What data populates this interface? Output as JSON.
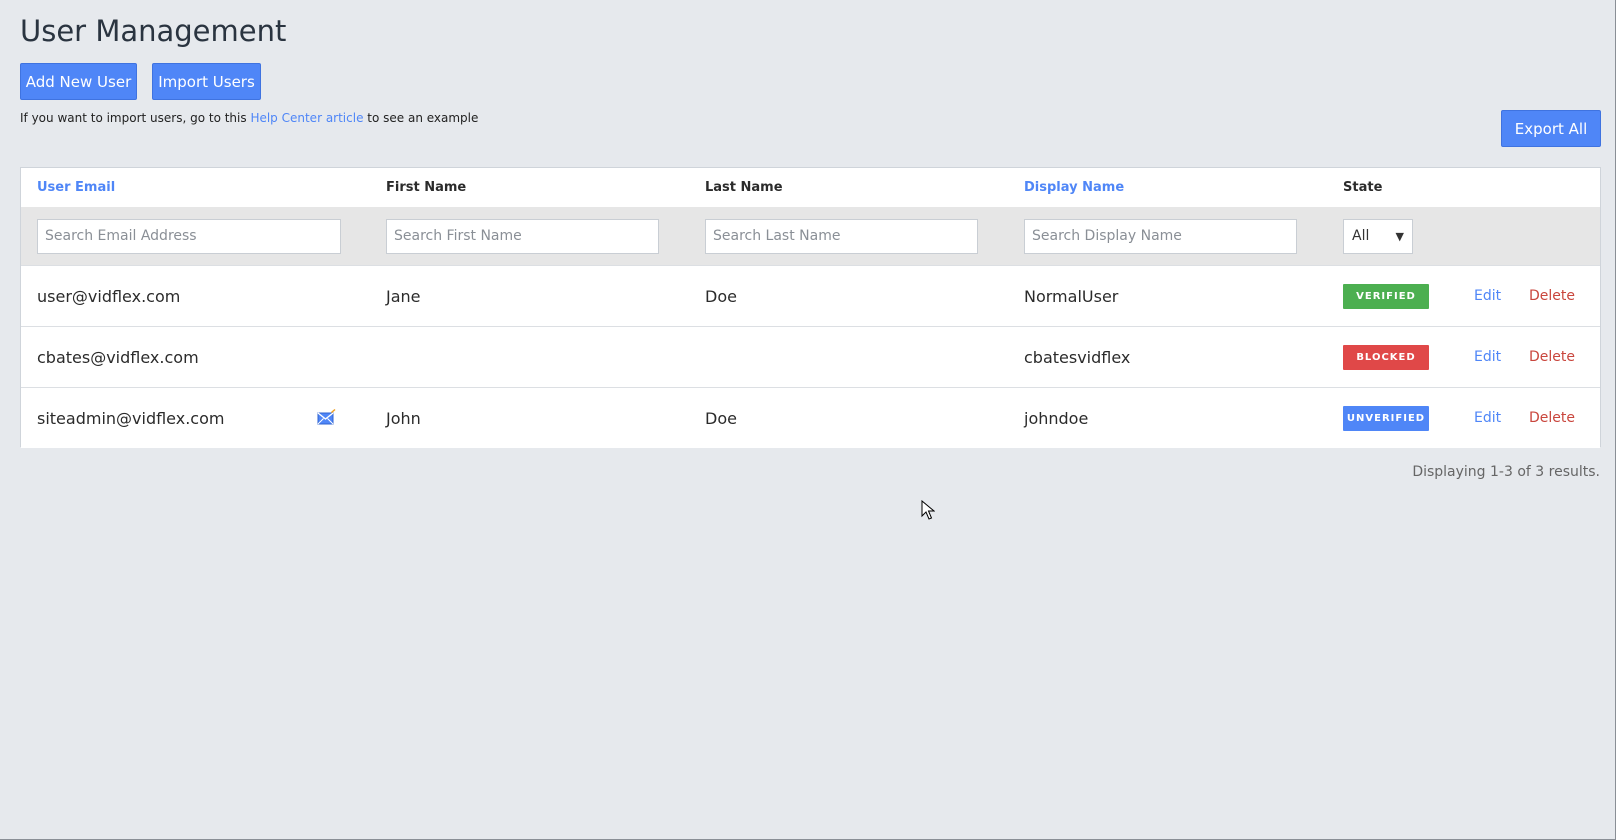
{
  "page": {
    "title": "User Management"
  },
  "actions": {
    "add_user": "Add New User",
    "import_users": "Import Users",
    "export_all": "Export All"
  },
  "help": {
    "prefix": "If you want to import users, go to this ",
    "link": "Help Center article",
    "suffix": " to see an example"
  },
  "table": {
    "columns": {
      "email": "User Email",
      "first_name": "First Name",
      "last_name": "Last Name",
      "display_name": "Display Name",
      "state": "State"
    },
    "filters": {
      "email_placeholder": "Search Email Address",
      "first_placeholder": "Search First Name",
      "last_placeholder": "Search Last Name",
      "display_placeholder": "Search Display Name",
      "state_selected": "All"
    },
    "rows": [
      {
        "email": "user@vidflex.com",
        "first_name": "Jane",
        "last_name": "Doe",
        "display_name": "NormalUser",
        "state": "VERIFIED",
        "edit": "Edit",
        "delete": "Delete"
      },
      {
        "email": "cbates@vidflex.com",
        "first_name": "",
        "last_name": "",
        "display_name": "cbatesvidflex",
        "state": "BLOCKED",
        "edit": "Edit",
        "delete": "Delete"
      },
      {
        "email": "siteadmin@vidflex.com",
        "first_name": "John",
        "last_name": "Doe",
        "display_name": "johndoe",
        "state": "UNVERIFIED",
        "edit": "Edit",
        "delete": "Delete",
        "icon": "resend-email-icon"
      }
    ]
  },
  "footer": {
    "results": "Displaying 1-3 of 3 results."
  },
  "colors": {
    "accent": "#4f86f7",
    "verified": "#4caf50",
    "blocked": "#e04848",
    "unverified": "#4f86f7",
    "delete": "#c9463d",
    "background": "#e6e9ed"
  }
}
